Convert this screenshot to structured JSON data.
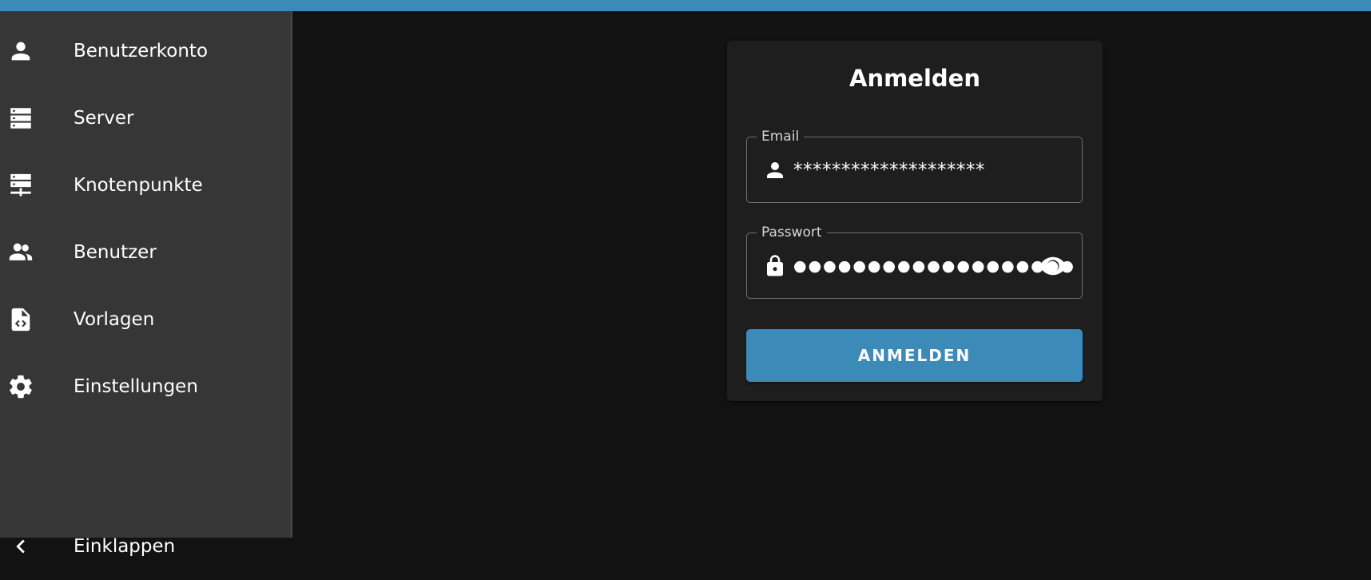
{
  "sidebar": {
    "items": [
      {
        "label": "Benutzerkonto",
        "icon": "account-icon"
      },
      {
        "label": "Server",
        "icon": "server-icon"
      },
      {
        "label": "Knotenpunkte",
        "icon": "lan-icon"
      },
      {
        "label": "Benutzer",
        "icon": "users-icon"
      },
      {
        "label": "Vorlagen",
        "icon": "file-code-icon"
      },
      {
        "label": "Einstellungen",
        "icon": "gear-icon"
      }
    ],
    "collapse_label": "Einklappen"
  },
  "login": {
    "title": "Anmelden",
    "email_label": "Email",
    "email_value": "********************",
    "password_label": "Passwort",
    "password_value": "●●●●●●●●●●●●●●●●●●●",
    "submit_label": "ANMELDEN"
  },
  "colors": {
    "accent": "#3b8ab7",
    "sidebar_bg": "#363636",
    "main_bg": "#121212",
    "card_bg": "#1e1e1e"
  }
}
